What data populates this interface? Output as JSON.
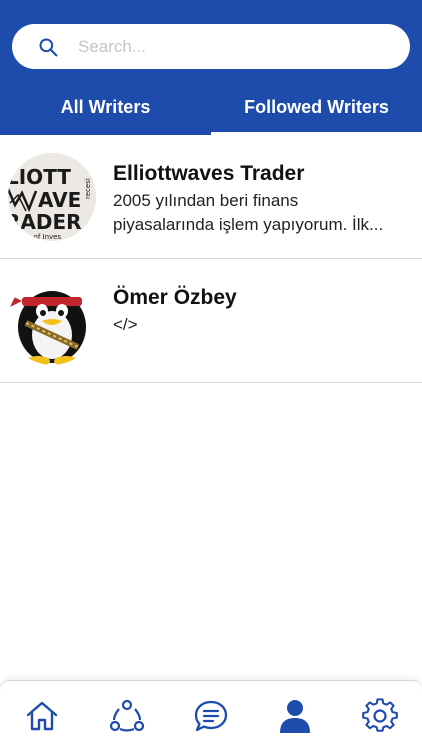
{
  "colors": {
    "brand": "#1d4cad",
    "tab_text": "#ffffff",
    "text": "#111111",
    "divider": "#d9d9d9"
  },
  "search": {
    "placeholder": "Search...",
    "value": ""
  },
  "tabs": [
    {
      "label": "All Writers",
      "active": false
    },
    {
      "label": "Followed Writers",
      "active": true
    }
  ],
  "writers": [
    {
      "name": "Elliottwaves Trader",
      "bio_line1": "2005 yılından beri finans",
      "bio_line2": "piyasalarında işlem yapıyorum. İlk...",
      "avatar_icon": "elliottwaves-logo-avatar",
      "avatar_text": {
        "l1": "LIOTT",
        "l2": "AVE",
        "l3": "RADER",
        "side": "recesi",
        "bottom": "rea of Inves"
      }
    },
    {
      "name": "Ömer Özbey",
      "bio_line1": "</>",
      "bio_line2": "",
      "avatar_icon": "penguin-avatar"
    }
  ],
  "bottom_nav": [
    {
      "icon": "home-icon"
    },
    {
      "icon": "share-network-icon"
    },
    {
      "icon": "chat-bubble-icon"
    },
    {
      "icon": "user-icon",
      "active": true
    },
    {
      "icon": "gear-icon"
    }
  ]
}
